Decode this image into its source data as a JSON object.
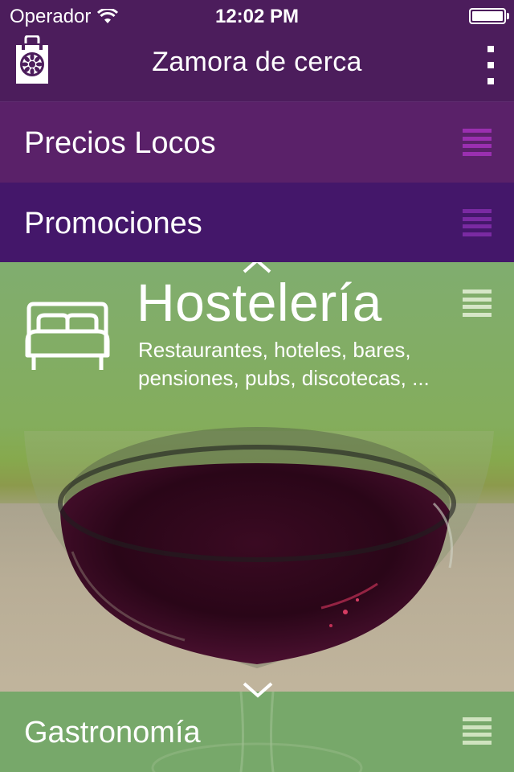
{
  "status": {
    "carrier": "Operador",
    "time": "12:02 PM"
  },
  "header": {
    "title": "Zamora de cerca",
    "logo_icon": "shopping-bag-rosette-icon",
    "menu_icon": "kebab-menu-icon"
  },
  "categories": [
    {
      "label": "Precios Locos",
      "icon": "hamburger-icon"
    },
    {
      "label": "Promociones",
      "icon": "hamburger-icon"
    }
  ],
  "featured": {
    "title": "Hostelería",
    "description": "Restaurantes, hoteles, bares, pensiones, pubs, discotecas, ...",
    "icon": "bed-icon",
    "image": "red-wine-glass"
  },
  "next_category": {
    "label": "Gastronomía",
    "icon": "hamburger-icon"
  },
  "colors": {
    "header_bg": "#4c1d5c",
    "precios_bg": "#5a2169",
    "promociones_bg": "#44176a",
    "accent_green": "#80ad6f",
    "gastronomia_bg": "#77a86a"
  }
}
